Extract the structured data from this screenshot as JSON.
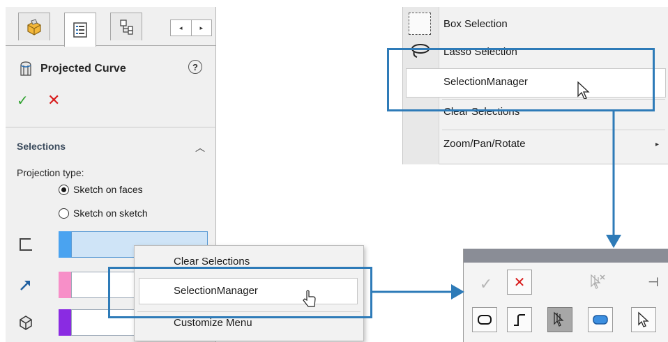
{
  "property_manager": {
    "tabs": [
      {
        "icon": "feature-manager-icon"
      },
      {
        "icon": "property-manager-icon"
      },
      {
        "icon": "configuration-manager-icon"
      }
    ],
    "scroll_left": "◂",
    "scroll_right": "▸",
    "title": "Projected Curve",
    "help": "?",
    "ok": "✓",
    "cancel": "✕",
    "section_title": "Selections",
    "collapse": "︿",
    "projection_type_label": "Projection type:",
    "options": [
      {
        "label": "Sketch on faces",
        "selected": true
      },
      {
        "label": "Sketch on sketch",
        "selected": false
      }
    ],
    "selection_boxes": [
      {
        "icon": "sketch-icon",
        "color": "#4aa3f0"
      },
      {
        "icon": "direction-arrow-icon",
        "color": "#f78fc8"
      },
      {
        "icon": "face-icon",
        "color": "#8a2be2"
      }
    ]
  },
  "context_menu_left": {
    "items": [
      "Clear Selections",
      "SelectionManager",
      "Customize Menu"
    ],
    "highlighted": "SelectionManager"
  },
  "context_menu_right": {
    "items": [
      "Box Selection",
      "Lasso Selection",
      "SelectionManager",
      "Clear Selections",
      "Zoom/Pan/Rotate"
    ],
    "highlighted": "SelectionManager",
    "submenu_arrow": "▸"
  },
  "selection_manager_toolbar": {
    "ok": "✓",
    "cancel": "✕",
    "pin": "⊣"
  },
  "colors": {
    "accent": "#2e7bb8",
    "ok_green": "#2ea12e",
    "cancel_red": "#d81b1b"
  }
}
